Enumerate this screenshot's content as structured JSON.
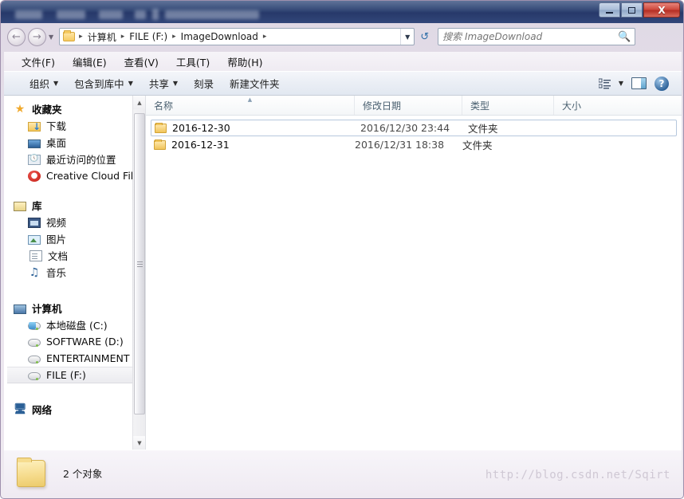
{
  "window": {
    "controls": {
      "minimize": "–",
      "maximize": "□",
      "close": "X"
    }
  },
  "addressbar": {
    "back_icon": "←",
    "forward_icon": "→",
    "history_caret": "▼",
    "folder_icon": "folder-icon",
    "crumb_separator": "▸",
    "crumbs": [
      "计算机",
      "FILE (F:)",
      "ImageDownload"
    ],
    "dropdown_caret": "▼",
    "refresh_icon": "↺"
  },
  "search": {
    "placeholder": "搜索 ImageDownload",
    "value": "",
    "icon": "🔍"
  },
  "menubar": {
    "items": [
      "文件(F)",
      "编辑(E)",
      "查看(V)",
      "工具(T)",
      "帮助(H)"
    ]
  },
  "toolbar": {
    "items": [
      {
        "label": "组织",
        "caret": "▼"
      },
      {
        "label": "包含到库中",
        "caret": "▼"
      },
      {
        "label": "共享",
        "caret": "▼"
      },
      {
        "label": "刻录",
        "caret": ""
      },
      {
        "label": "新建文件夹",
        "caret": ""
      }
    ],
    "view_caret": "▼",
    "help_label": "?"
  },
  "sidebar": {
    "groups": [
      {
        "root": {
          "label": "收藏夹",
          "icon": "star-icon"
        },
        "children": [
          {
            "label": "下载",
            "icon": "download-folder-icon",
            "selected": false
          },
          {
            "label": "桌面",
            "icon": "desktop-icon",
            "selected": false
          },
          {
            "label": "最近访问的位置",
            "icon": "recent-places-icon",
            "selected": false
          },
          {
            "label": "Creative Cloud Files",
            "icon": "creative-cloud-icon",
            "selected": false
          }
        ]
      },
      {
        "root": {
          "label": "库",
          "icon": "library-icon"
        },
        "children": [
          {
            "label": "视频",
            "icon": "video-icon",
            "selected": false
          },
          {
            "label": "图片",
            "icon": "pictures-icon",
            "selected": false
          },
          {
            "label": "文档",
            "icon": "documents-icon",
            "selected": false
          },
          {
            "label": "音乐",
            "icon": "music-icon",
            "selected": false
          }
        ]
      },
      {
        "root": {
          "label": "计算机",
          "icon": "computer-icon"
        },
        "children": [
          {
            "label": "本地磁盘 (C:)",
            "icon": "system-drive-icon",
            "selected": false
          },
          {
            "label": "SOFTWARE (D:)",
            "icon": "drive-icon",
            "selected": false
          },
          {
            "label": "ENTERTAINMENT (E",
            "icon": "drive-icon",
            "selected": false
          },
          {
            "label": "FILE (F:)",
            "icon": "drive-icon",
            "selected": true
          }
        ]
      },
      {
        "root": {
          "label": "网络",
          "icon": "network-icon"
        },
        "children": []
      }
    ],
    "scrollbar": {
      "up_arrow": "▲",
      "down_arrow": "▼"
    }
  },
  "filelist": {
    "columns": [
      {
        "label": "名称",
        "sorted": true,
        "sort_arrow": "▲"
      },
      {
        "label": "修改日期",
        "sorted": false,
        "sort_arrow": ""
      },
      {
        "label": "类型",
        "sorted": false,
        "sort_arrow": ""
      },
      {
        "label": "大小",
        "sorted": false,
        "sort_arrow": ""
      }
    ],
    "rows": [
      {
        "name": "2016-12-30",
        "date": "2016/12/30 23:44",
        "type": "文件夹",
        "size": "",
        "focused": true,
        "icon": "folder-icon"
      },
      {
        "name": "2016-12-31",
        "date": "2016/12/31 18:38",
        "type": "文件夹",
        "size": "",
        "focused": false,
        "icon": "folder-icon"
      }
    ]
  },
  "statusbar": {
    "icon": "folder-icon",
    "text": "2 个对象"
  },
  "watermark": {
    "text": "http://blog.csdn.net/Sqirt"
  },
  "colors": {
    "titlebar": "#2e4372",
    "close_button": "#cf4a3e",
    "accent_blue": "#2f6fa8",
    "folder_yellow": "#f0c45a",
    "selection": "#ebebef"
  }
}
